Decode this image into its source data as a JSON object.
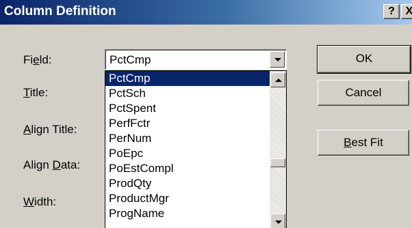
{
  "window": {
    "title": "Column Definition",
    "help_label": "?",
    "close_label": "X"
  },
  "labels": {
    "field": {
      "pre": "Fi",
      "key": "e",
      "post": "ld:"
    },
    "title": {
      "pre": "",
      "key": "T",
      "post": "itle:"
    },
    "align_title": {
      "pre": "",
      "key": "A",
      "post": "lign Title:"
    },
    "align_data": {
      "pre": "Align ",
      "key": "D",
      "post": "ata:"
    },
    "width": {
      "pre": "",
      "key": "W",
      "post": "idth:"
    }
  },
  "field_combo": {
    "value": "PctCmp",
    "items": [
      "PctCmp",
      "PctSch",
      "PctSpent",
      "PerfFctr",
      "PerNum",
      "PoEpc",
      "PoEstCompl",
      "ProdQty",
      "ProductMgr",
      "ProgName"
    ],
    "selected_index": 0
  },
  "buttons": {
    "ok": "OK",
    "cancel": "Cancel",
    "best_fit": {
      "key": "B",
      "post": "est Fit"
    }
  }
}
